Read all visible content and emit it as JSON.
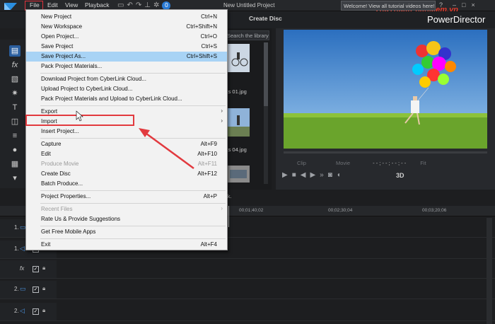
{
  "menubar": {
    "items": [
      "File",
      "Edit",
      "View",
      "Playback"
    ],
    "title": "New Untitled Project",
    "welcome": "Welcome! View all tutorial videos here!",
    "help": "?",
    "watermark": "ThuThuatPhanMem.vn"
  },
  "subheader": {
    "create_disc": "Create Disc",
    "brand": "PowerDirector"
  },
  "library": {
    "search_placeholder": "Search the library",
    "captions": [
      "rts 01.jpg",
      "rts 04.jpg"
    ]
  },
  "preview": {
    "modes": [
      "Clip",
      "Movie"
    ],
    "timecode": "- - ; - - ; - - ; - -",
    "fit": "Fit",
    "three_d": "3D"
  },
  "timeline": {
    "partial_text": "ck.",
    "ticks": [
      "00;01;40;02",
      "00;02;30;04",
      "00;03;20;06"
    ],
    "tracks": [
      "1.",
      "1.",
      "fx",
      "2.",
      "2."
    ]
  },
  "file_menu": {
    "items": [
      {
        "label": "New Project",
        "shortcut": "Ctrl+N"
      },
      {
        "label": "New Workspace",
        "shortcut": "Ctrl+Shift+N"
      },
      {
        "label": "Open Project...",
        "shortcut": "Ctrl+O"
      },
      {
        "label": "Save Project",
        "shortcut": "Ctrl+S"
      },
      {
        "label": "Save Project As...",
        "shortcut": "Ctrl+Shift+S"
      },
      {
        "label": "Pack Project Materials...",
        "shortcut": ""
      },
      {
        "label": "Download Project from CyberLink Cloud...",
        "shortcut": ""
      },
      {
        "label": "Upload Project to CyberLink Cloud...",
        "shortcut": ""
      },
      {
        "label": "Pack Project Materials and Upload to CyberLink Cloud...",
        "shortcut": ""
      },
      {
        "label": "Export",
        "shortcut": ""
      },
      {
        "label": "Import",
        "shortcut": ""
      },
      {
        "label": "Insert Project...",
        "shortcut": ""
      },
      {
        "label": "Capture",
        "shortcut": "Alt+F9"
      },
      {
        "label": "Edit",
        "shortcut": "Alt+F10"
      },
      {
        "label": "Produce Movie",
        "shortcut": "Alt+F11"
      },
      {
        "label": "Create Disc",
        "shortcut": "Alt+F12"
      },
      {
        "label": "Batch Produce...",
        "shortcut": ""
      },
      {
        "label": "Project Properties...",
        "shortcut": "Alt+P"
      },
      {
        "label": "Recent Files",
        "shortcut": ""
      },
      {
        "label": "Rate Us & Provide Suggestions",
        "shortcut": ""
      },
      {
        "label": "Get Free Mobile Apps",
        "shortcut": ""
      },
      {
        "label": "Exit",
        "shortcut": "Alt+F4"
      }
    ]
  },
  "colors": {
    "highlight": "#a8d3f5",
    "annotation_red": "#e23a3f",
    "accent_blue": "#2a7bd5"
  }
}
